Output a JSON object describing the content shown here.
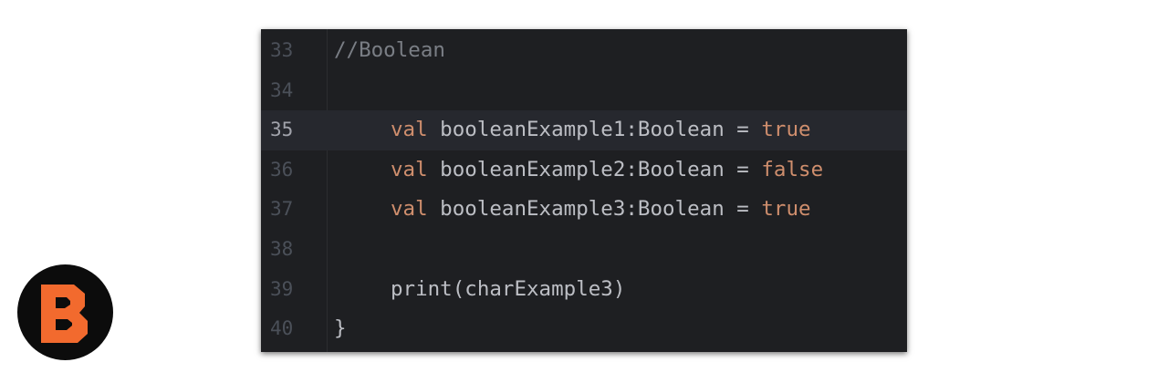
{
  "editor": {
    "lines": [
      {
        "number": "33",
        "comment": "//Boolean"
      },
      {
        "number": "34"
      },
      {
        "number": "35",
        "keyword": "val",
        "text": " booleanExample1:Boolean = ",
        "value": "true",
        "current": true
      },
      {
        "number": "36",
        "keyword": "val",
        "text": " booleanExample2:Boolean = ",
        "value": "false"
      },
      {
        "number": "37",
        "keyword": "val",
        "text": " booleanExample3:Boolean = ",
        "value": "true"
      },
      {
        "number": "38"
      },
      {
        "number": "39",
        "text": "print(charExample3)"
      },
      {
        "number": "40",
        "text": "}"
      }
    ]
  },
  "colors": {
    "background": "#1e1f22",
    "current_line": "#26282e",
    "keyword": "#cf8e6d",
    "comment": "#7a7e85",
    "text": "#bcbec4",
    "gutter_text": "#4b5059",
    "logo_orange": "#f26a2e",
    "logo_background": "#0c0c0c"
  },
  "logo": {
    "icon": "brand-b-logo"
  }
}
